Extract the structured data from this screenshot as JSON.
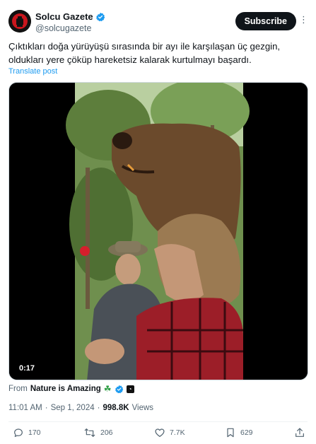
{
  "author": {
    "name": "Solcu Gazete",
    "handle": "@solcugazete",
    "subscribe_label": "Subscribe"
  },
  "tweet": {
    "text": "Çıktıkları doğa yürüyüşü sırasında bir ayı ile karşılaşan üç gezgin, oldukları yere çöküp hareketsiz kalarak kurtulmayı başardı.",
    "translate_label": "Translate post"
  },
  "media": {
    "duration": "0:17"
  },
  "attribution": {
    "from_label": "From",
    "source_name": "Nature is Amazing"
  },
  "meta": {
    "time": "11:01 AM",
    "separator": "·",
    "date": "Sep 1, 2024",
    "views_count": "998.8K",
    "views_label": "Views"
  },
  "actions": {
    "replies": "170",
    "reposts": "206",
    "likes": "7.7K",
    "bookmarks": "629"
  },
  "colors": {
    "accent": "#1d9bf0",
    "text": "#0f1419",
    "muted": "#536471"
  }
}
